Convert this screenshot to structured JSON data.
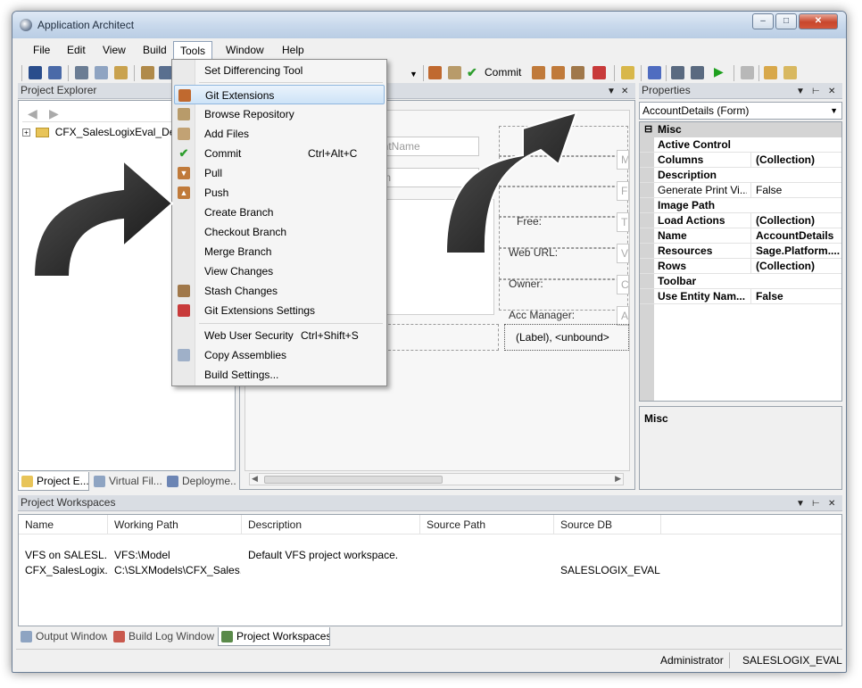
{
  "window": {
    "title": "Application Architect"
  },
  "menubar": [
    "File",
    "Edit",
    "View",
    "Build",
    "Tools",
    "Window",
    "Help"
  ],
  "toolbar": {
    "commit_label": "Commit"
  },
  "tools_menu": {
    "items": [
      {
        "label": "Set Differencing Tool",
        "shortcut": "",
        "icon": "none"
      },
      {
        "label": "Git Extensions",
        "shortcut": "",
        "icon": "git-extensions-icon",
        "highlighted": true
      },
      {
        "label": "Browse Repository",
        "shortcut": "",
        "icon": "browse-repository-icon"
      },
      {
        "label": "Add Files",
        "shortcut": "",
        "icon": "add-files-icon"
      },
      {
        "label": "Commit",
        "shortcut": "Ctrl+Alt+C",
        "icon": "check-icon"
      },
      {
        "label": "Pull",
        "shortcut": "",
        "icon": "pull-icon"
      },
      {
        "label": "Push",
        "shortcut": "",
        "icon": "push-icon"
      },
      {
        "label": "Create Branch",
        "shortcut": "",
        "icon": "none"
      },
      {
        "label": "Checkout Branch",
        "shortcut": "",
        "icon": "none"
      },
      {
        "label": "Merge Branch",
        "shortcut": "",
        "icon": "none"
      },
      {
        "label": "View Changes",
        "shortcut": "",
        "icon": "none"
      },
      {
        "label": "Stash Changes",
        "shortcut": "",
        "icon": "stash-icon"
      },
      {
        "label": "Git Extensions Settings",
        "shortcut": "",
        "icon": "settings-icon"
      },
      {
        "label": "Web User Security",
        "shortcut": "Ctrl+Shift+S",
        "icon": "none"
      },
      {
        "label": "Copy Assemblies",
        "shortcut": "",
        "icon": "copy-assemblies-icon"
      },
      {
        "label": "Build Settings...",
        "shortcut": "",
        "icon": "none"
      }
    ]
  },
  "project_explorer": {
    "title": "Project Explorer",
    "tree_root": "CFX_SalesLogixEval_Dem",
    "tabs": [
      "Project E...",
      "Virtual Fil...",
      "Deployme..."
    ]
  },
  "designer": {
    "fields": [
      "untName",
      "ion"
    ],
    "labels": [
      "Free:",
      "Web URL:",
      "Owner:",
      "Acc Manager:"
    ],
    "right_stubs": [
      "M",
      "F",
      "T",
      "V",
      "C",
      "A"
    ],
    "unbound": "(Label), <unbound>"
  },
  "properties": {
    "title": "Properties",
    "selector": "AccountDetails (Form)",
    "category": "Misc",
    "rows": [
      {
        "name": "Active Control",
        "value": "",
        "bold": true
      },
      {
        "name": "Columns",
        "value": "(Collection)",
        "bold": true
      },
      {
        "name": "Description",
        "value": "",
        "bold": true
      },
      {
        "name": "Generate Print Vi...",
        "value": "False",
        "bold": false
      },
      {
        "name": "Image Path",
        "value": "",
        "bold": true
      },
      {
        "name": "Load Actions",
        "value": "(Collection)",
        "bold": true
      },
      {
        "name": "Name",
        "value": "AccountDetails",
        "bold": true
      },
      {
        "name": "Resources",
        "value": "Sage.Platform....",
        "bold": true
      },
      {
        "name": "Rows",
        "value": "(Collection)",
        "bold": true
      },
      {
        "name": "Toolbar",
        "value": "",
        "bold": true
      },
      {
        "name": "Use Entity Nam...",
        "value": "False",
        "bold": true
      }
    ],
    "description_title": "Misc"
  },
  "workspaces": {
    "title": "Project Workspaces",
    "columns": [
      "Name",
      "Working Path",
      "Description",
      "Source Path",
      "Source DB"
    ],
    "rows": [
      [
        "VFS on SALESL...",
        "VFS:\\Model",
        "Default VFS project workspace.",
        "",
        ""
      ],
      [
        "CFX_SalesLogix...",
        "C:\\SLXModels\\CFX_Sales...",
        "",
        "",
        "SALESLOGIX_EVAL"
      ]
    ],
    "tabs": [
      "Output Window",
      "Build Log Window",
      "Project Workspaces"
    ]
  },
  "status": {
    "user": "Administrator",
    "db": "SALESLOGIX_EVAL"
  }
}
